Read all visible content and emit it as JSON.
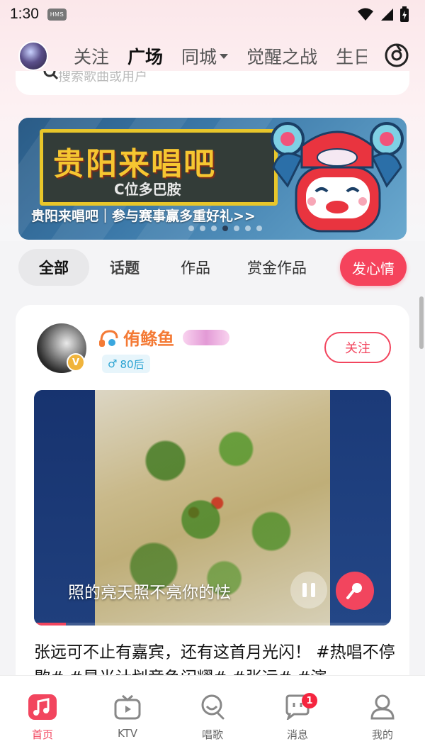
{
  "status_bar": {
    "time": "1:30",
    "badge": "HMS",
    "icons": [
      "wifi-icon",
      "signal-icon",
      "battery-icon"
    ]
  },
  "top_nav": {
    "tabs": [
      {
        "label": "关注"
      },
      {
        "label": "广场",
        "active": true
      },
      {
        "label": "同城",
        "has_dropdown": true
      },
      {
        "label": "觉醒之战"
      },
      {
        "label": "生日"
      }
    ],
    "right_icon": "scan-icon"
  },
  "search": {
    "placeholder": "搜索歌曲或用户"
  },
  "banner": {
    "title": "贵阳来唱吧",
    "subtitle": "C位多巴胺",
    "caption": "贵阳来唱吧｜参与赛事赢多重好礼>>",
    "dots": 7,
    "active_dot": 3
  },
  "filters": {
    "items": [
      {
        "label": "全部",
        "active": true
      },
      {
        "label": "话题"
      },
      {
        "label": "作品"
      },
      {
        "label": "赏金作品"
      }
    ],
    "post_button": "发心情"
  },
  "post": {
    "author": {
      "name": "侑鲦鱼",
      "level_badge": "",
      "tag": "80后",
      "gender_icon": "male-icon",
      "verified": true
    },
    "follow_button": "关注",
    "lyric": "照的亮天照不亮你的怯",
    "progress": 0.09,
    "text": "张远可不止有嘉宾，还有这首月光闪！ #热唱不停歇# #星光计划竞争闪耀# #张远# #演"
  },
  "bottom_nav": {
    "items": [
      {
        "label": "首页",
        "icon": "home-music-icon",
        "active": true
      },
      {
        "label": "KTV",
        "icon": "tv-icon"
      },
      {
        "label": "唱歌",
        "icon": "sing-icon"
      },
      {
        "label": "消息",
        "icon": "message-icon",
        "badge": "1"
      },
      {
        "label": "我的",
        "icon": "profile-icon"
      }
    ]
  },
  "colors": {
    "accent": "#f2455e",
    "author_name": "#f47a35",
    "tag_blue": "#2aa3d2"
  }
}
